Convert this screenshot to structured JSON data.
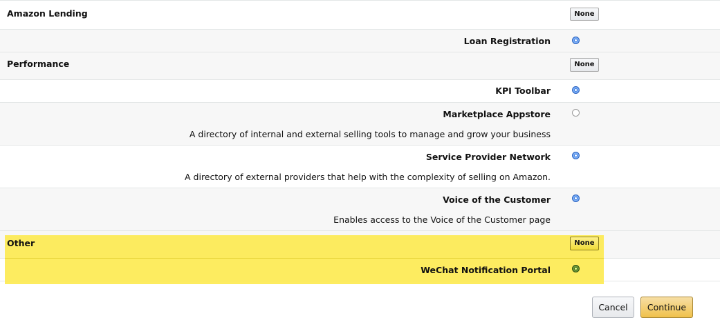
{
  "sections": {
    "lending": {
      "title": "Amazon Lending",
      "none_label": "None",
      "items": [
        {
          "label": "Loan Registration",
          "state": "selected"
        }
      ]
    },
    "performance": {
      "title": "Performance",
      "none_label": "None",
      "items": [
        {
          "label": "KPI Toolbar",
          "state": "selected"
        },
        {
          "label": "Marketplace Appstore",
          "description": "A directory of internal and external selling tools to manage and grow your business",
          "state": "unselected"
        },
        {
          "label": "Service Provider Network",
          "description": "A directory of external providers that help with the complexity of selling on Amazon.",
          "state": "selected"
        },
        {
          "label": "Voice of the Customer",
          "description": "Enables access to the Voice of the Customer page",
          "state": "selected"
        }
      ]
    },
    "other": {
      "title": "Other",
      "none_label": "None",
      "highlight_color": "#fde94a",
      "items": [
        {
          "label": "WeChat Notification Portal",
          "state": "selected"
        }
      ]
    }
  },
  "footer": {
    "cancel_label": "Cancel",
    "continue_label": "Continue"
  },
  "colors": {
    "radio_selected": "#3d7ee3",
    "continue_button": "#f0c14b",
    "row_alt_background": "#f7f7f7"
  }
}
